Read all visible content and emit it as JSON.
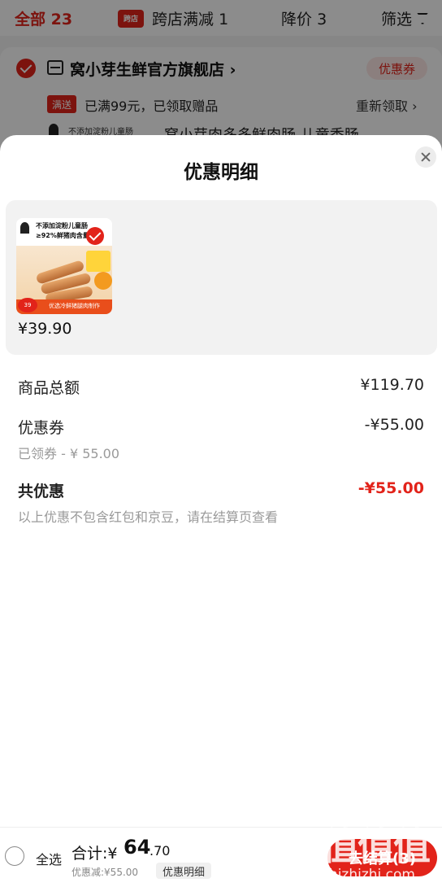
{
  "filter_bar": {
    "all_label": "全部",
    "all_count": "23",
    "cross_store_flag": "跨店",
    "cross_store_label": "跨店满减",
    "cross_store_count": "1",
    "price_drop_label": "降价",
    "price_drop_count": "3",
    "filter_label": "筛选"
  },
  "store": {
    "name": "窝小芽生鲜官方旗舰店 ›",
    "coupon_tag": "优惠券",
    "gift_tag": "满送",
    "gift_text": "已满99元，已领取赠品",
    "regain_link": "重新领取 ›",
    "product_mini_text": "不添加淀粉儿童肠",
    "product_title": "窝小芽肉多多鲜肉肠 儿童香肠"
  },
  "sheet": {
    "title": "优惠明细",
    "product_image": {
      "line1": "不添加淀粉儿童肠",
      "line2": "≥92%鲜猪肉含量",
      "price_badge": "39",
      "banner_text": "优选冷鲜猪腿肉制作"
    },
    "product_price": "¥39.90",
    "goods_total_label": "商品总额",
    "goods_total_value": "¥119.70",
    "coupon_label": "优惠券",
    "coupon_value": "-¥55.00",
    "coupon_sub": "已领券 - ¥ 55.00",
    "total_discount_label": "共优惠",
    "total_discount_value": "-¥55.00",
    "note": "以上优惠不包含红包和京豆，请在结算页查看"
  },
  "bottom_bar": {
    "select_all": "全选",
    "total_label": "合计:¥",
    "total_int": "64",
    "total_dec": ".70",
    "discount_label": "优惠减:¥55.00",
    "detail_tag": "优惠明细",
    "checkout": "去结算(3)"
  },
  "watermark": {
    "logo": "值值值",
    "domain": "zhizhizhi.com"
  },
  "colors": {
    "accent": "#e2231a",
    "muted_text": "#9a9a9a",
    "panel_bg": "#f2f2f2"
  }
}
